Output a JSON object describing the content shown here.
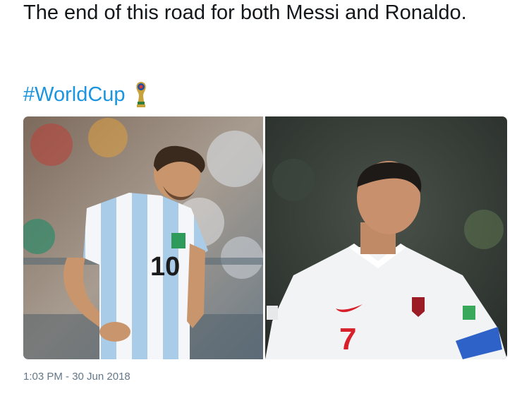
{
  "tweet": {
    "text": "The end of this road for both Messi and Ronaldo.",
    "hashtag": "#WorldCup",
    "timestamp": "1:03 PM - 30 Jun 2018"
  },
  "media": {
    "left_photo": {
      "jersey_number": "10",
      "subject": "messi-argentina-photo"
    },
    "right_photo": {
      "jersey_number": "7",
      "subject": "ronaldo-portugal-photo"
    }
  },
  "colors": {
    "text": "#14171a",
    "link": "#1b95e0",
    "meta": "#657786"
  }
}
